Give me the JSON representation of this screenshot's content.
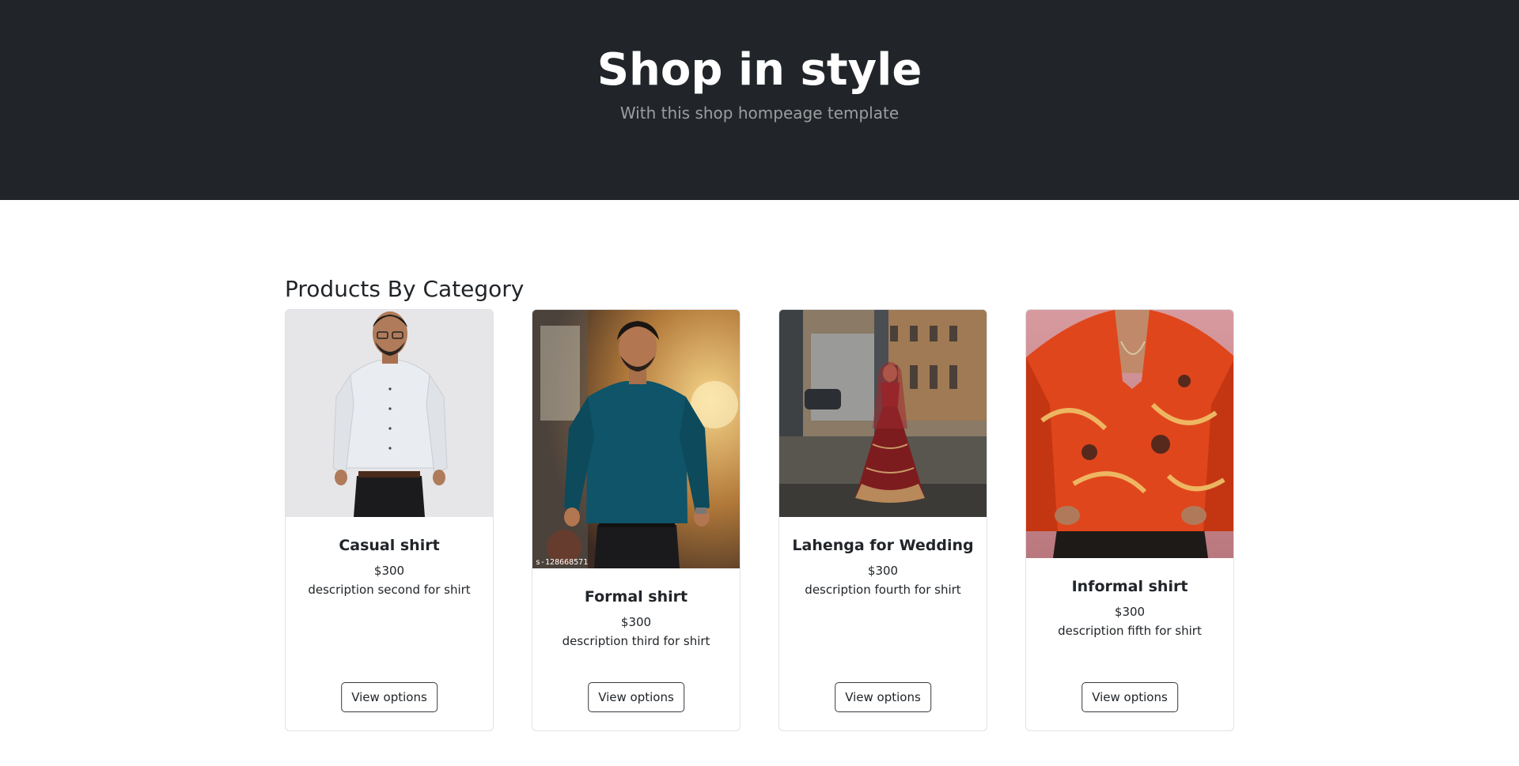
{
  "hero": {
    "title": "Shop in style",
    "subtitle": "With this shop hompeage template"
  },
  "section": {
    "title": "Products By Category"
  },
  "products": [
    {
      "title": "Casual shirt",
      "price": "$300",
      "description": "description second for shirt",
      "button": "View options"
    },
    {
      "title": "Formal shirt",
      "price": "$300",
      "description": "description third for shirt",
      "button": "View options",
      "image_text": "s-128668571"
    },
    {
      "title": "Lahenga for Wedding",
      "price": "$300",
      "description": "description fourth for shirt",
      "button": "View options"
    },
    {
      "title": "Informal shirt",
      "price": "$300",
      "description": "description fifth for shirt",
      "button": "View options"
    }
  ],
  "colors": {
    "hero_bg": "#212529",
    "button_border": "#343a40"
  }
}
